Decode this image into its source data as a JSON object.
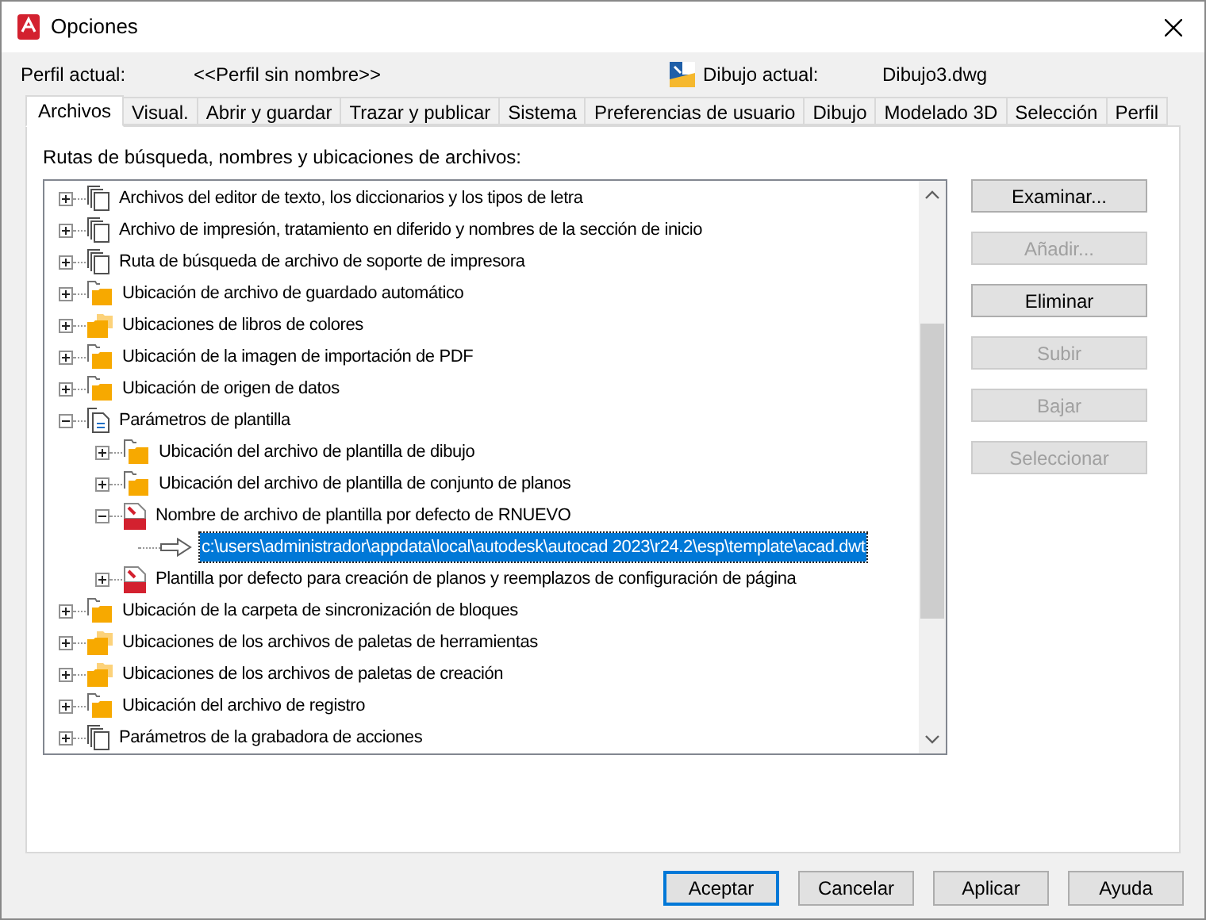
{
  "window": {
    "title": "Opciones"
  },
  "profile": {
    "label": "Perfil actual:",
    "value": "<<Perfil sin nombre>>",
    "drawing_label": "Dibujo actual:",
    "drawing_value": "Dibujo3.dwg"
  },
  "tabs": [
    {
      "label": "Archivos",
      "selected": true
    },
    {
      "label": "Visual.",
      "selected": false
    },
    {
      "label": "Abrir y guardar",
      "selected": false
    },
    {
      "label": "Trazar y publicar",
      "selected": false
    },
    {
      "label": "Sistema",
      "selected": false
    },
    {
      "label": "Preferencias de usuario",
      "selected": false
    },
    {
      "label": "Dibujo",
      "selected": false
    },
    {
      "label": "Modelado 3D",
      "selected": false
    },
    {
      "label": "Selección",
      "selected": false
    },
    {
      "label": "Perfil",
      "selected": false
    }
  ],
  "tree_label": "Rutas de búsqueda, nombres y ubicaciones de archivos:",
  "tree": [
    {
      "kind": "docs",
      "label": "Archivos del editor de texto, los diccionarios y los tipos de letra",
      "expanded": false
    },
    {
      "kind": "docs",
      "label": "Archivo de impresión, tratamiento en diferido y nombres de la sección de inicio",
      "expanded": false
    },
    {
      "kind": "docs",
      "label": "Ruta de búsqueda de archivo de soporte de impresora",
      "expanded": false
    },
    {
      "kind": "folder",
      "label": "Ubicación de archivo de guardado automático",
      "expanded": false
    },
    {
      "kind": "folders",
      "label": "Ubicaciones de libros de colores",
      "expanded": false
    },
    {
      "kind": "folder",
      "label": "Ubicación de la imagen de importación de PDF",
      "expanded": false
    },
    {
      "kind": "folder",
      "label": "Ubicación de origen de datos",
      "expanded": false
    },
    {
      "kind": "template",
      "label": "Parámetros de plantilla",
      "expanded": true,
      "children": [
        {
          "kind": "folder",
          "label": "Ubicación del archivo de plantilla de dibujo",
          "expanded": false
        },
        {
          "kind": "folder",
          "label": "Ubicación del archivo de plantilla de conjunto de planos",
          "expanded": false
        },
        {
          "kind": "dwt",
          "label": "Nombre de archivo de plantilla por defecto de RNUEVO",
          "expanded": true,
          "children": [
            {
              "kind": "path",
              "label": "c:\\users\\administrador\\appdata\\local\\autodesk\\autocad 2023\\r24.2\\esp\\template\\acad.dwt",
              "selected": true
            }
          ]
        },
        {
          "kind": "dwt",
          "label": "Plantilla por defecto para creación de planos y reemplazos de configuración de página",
          "expanded": false
        }
      ]
    },
    {
      "kind": "folder",
      "label": "Ubicación de la carpeta de sincronización de bloques",
      "expanded": false
    },
    {
      "kind": "folders",
      "label": "Ubicaciones de los archivos de paletas de herramientas",
      "expanded": false
    },
    {
      "kind": "folders",
      "label": "Ubicaciones de los archivos de paletas de creación",
      "expanded": false
    },
    {
      "kind": "folder",
      "label": "Ubicación del archivo de registro",
      "expanded": false
    },
    {
      "kind": "docs",
      "label": "Parámetros de la grabadora de acciones",
      "expanded": false
    }
  ],
  "side_buttons": [
    {
      "label": "Examinar...",
      "disabled": false
    },
    {
      "label": "Añadir...",
      "disabled": true
    },
    {
      "label": "Eliminar",
      "disabled": false
    },
    {
      "label": "Subir",
      "disabled": true
    },
    {
      "label": "Bajar",
      "disabled": true
    },
    {
      "label": "Seleccionar",
      "disabled": true
    }
  ],
  "footer_buttons": [
    {
      "label": "Aceptar",
      "default": true
    },
    {
      "label": "Cancelar",
      "default": false
    },
    {
      "label": "Aplicar",
      "default": false
    },
    {
      "label": "Ayuda",
      "default": false
    }
  ]
}
